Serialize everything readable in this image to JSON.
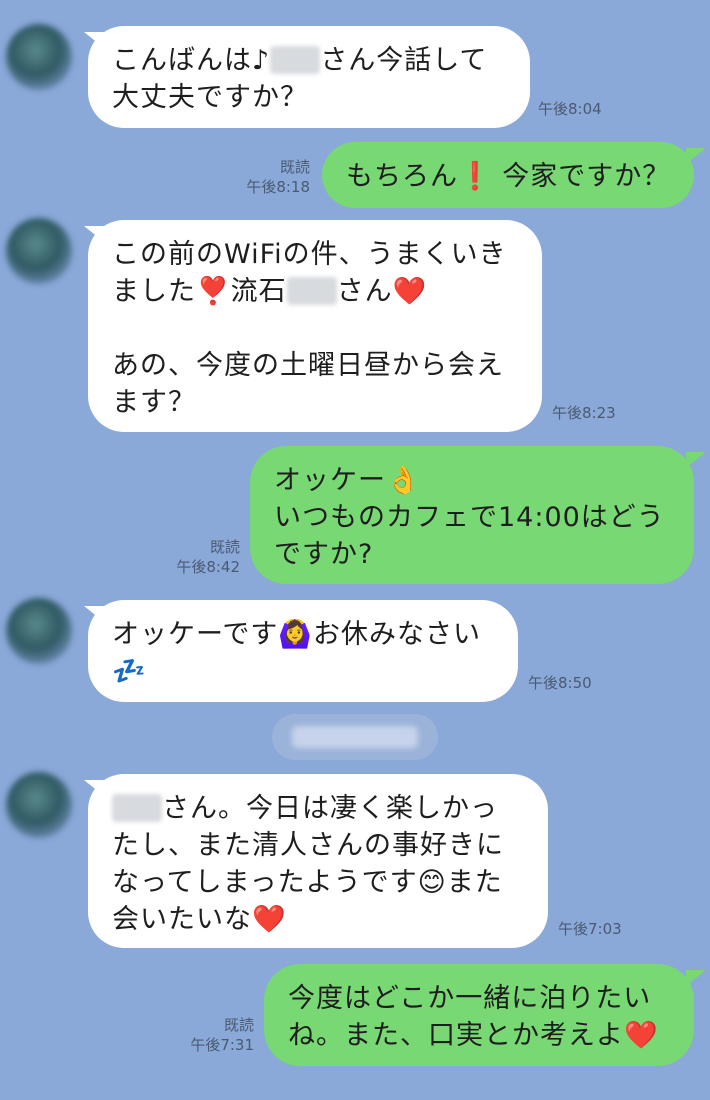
{
  "messages": [
    {
      "from": "in",
      "parts": [
        "こんばんは♪",
        "[blurred]",
        "さん今話して\n大丈夫ですか？"
      ],
      "time": "午後8:04"
    },
    {
      "from": "out",
      "text": "もちろん❗️ 今家ですか？",
      "read": "既読",
      "time": "午後8:18"
    },
    {
      "from": "in",
      "text_a": "この前のWiFiの件、うまくいき\nました❣️流石",
      "text_b": "さん❤️\n\nあの、今度の土曜日昼から会え\nます？",
      "time": "午後8:23"
    },
    {
      "from": "out",
      "text": "オッケー👌\nいつものカフェで14:00はどう\nですか?",
      "read": "既読",
      "time": "午後8:42"
    },
    {
      "from": "in",
      "text": "オッケーです🙆‍♀️お休みなさい",
      "extra": "💤",
      "time": "午後8:50"
    },
    {
      "from": "in",
      "text": "さん。今日は凄く楽しかっ\nたし、また清人さんの事好きに\nなってしまったようです😊また\n会いたいな❤️",
      "time": "午後7:03"
    },
    {
      "from": "out",
      "text": "今度はどこか一緒に泊りたい\nね。また、口実とか考えよ❤️",
      "read": "既読",
      "time": "午後7:31"
    }
  ],
  "colors": {
    "background": "#8aa8d8",
    "incoming": "#ffffff",
    "outgoing": "#78d873"
  }
}
